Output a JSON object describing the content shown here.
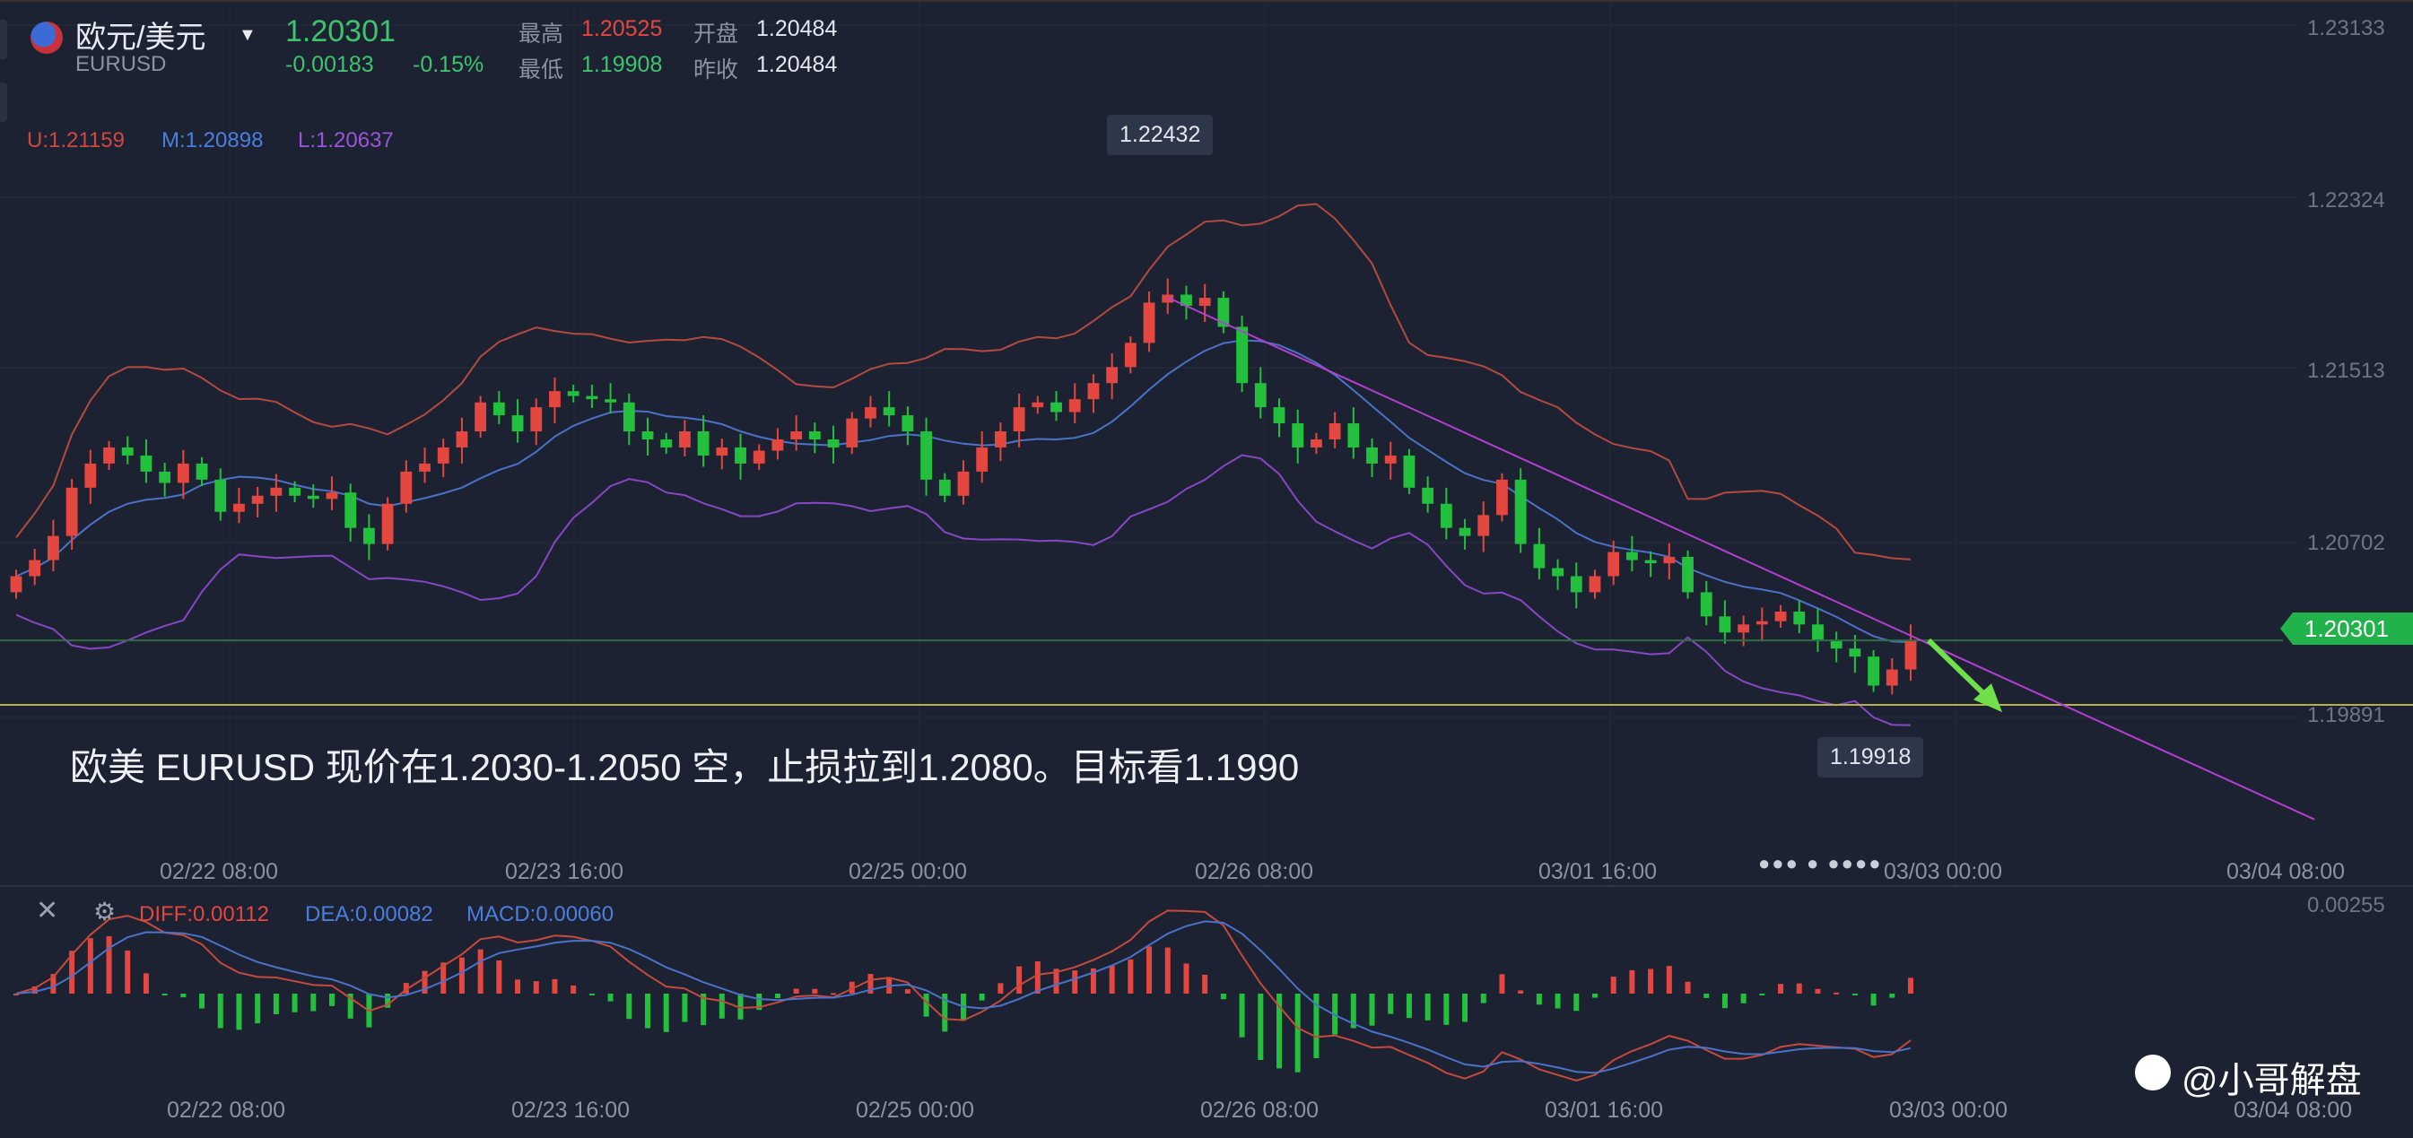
{
  "header": {
    "symbol_name": "欧元/美元",
    "symbol_code": "EURUSD",
    "price": "1.20301",
    "change": "-0.00183",
    "change_pct": "-0.15%",
    "high_label": "最高",
    "high": "1.20525",
    "low_label": "最低",
    "low": "1.19908",
    "open_label": "开盘",
    "open": "1.20484",
    "prev_close_label": "昨收",
    "prev_close": "1.20484"
  },
  "bollinger": {
    "upper": "U:1.21159",
    "middle": "M:1.20898",
    "lower": "L:1.20637"
  },
  "colors": {
    "up": "#e4473f",
    "down": "#22c03c",
    "upper": "#b44a3f",
    "middle": "#4a72c8",
    "lower": "#8746c4",
    "trendline": "#b43fd0",
    "arrow": "#6fe04a",
    "support": "#b8b04a",
    "price_line": "#2f6e43"
  },
  "annotations": {
    "high_tip": "1.22432",
    "low_tip": "1.19918",
    "current_price_tag": "1.20301",
    "note": "欧美 EURUSD 现价在1.2030-1.2050 空，止损拉到1.2080。目标看1.1990"
  },
  "y_axis": {
    "ticks": [
      "1.23133",
      "1.22324",
      "1.21513",
      "1.20702",
      "1.19891"
    ]
  },
  "x_axis": {
    "ticks": [
      "02/22 08:00",
      "02/23 16:00",
      "02/25 00:00",
      "02/26 08:00",
      "03/01 16:00",
      "03/03 00:00",
      "03/04 08:00"
    ]
  },
  "macd": {
    "close_icon": "close-icon",
    "settings_icon": "settings-icon",
    "diff": "DIFF:0.00112",
    "dea": "DEA:0.00082",
    "macd": "MACD:0.00060",
    "y_tick": "0.00255",
    "x_ticks": [
      "02/22 08:00",
      "02/23 16:00",
      "02/25 00:00",
      "02/26 08:00",
      "03/01 16:00",
      "03/03 00:00",
      "03/04 08:00"
    ]
  },
  "watermark": "@小哥解盘",
  "chart_data": {
    "type": "candlestick",
    "symbol": "EURUSD",
    "y_range": [
      1.1985,
      1.2325
    ],
    "trend": {
      "closes": [
        1.207,
        1.208,
        1.2095,
        1.2125,
        1.214,
        1.215,
        1.2145,
        1.2135,
        1.2128,
        1.214,
        1.213,
        1.211,
        1.2115,
        1.212,
        1.2125,
        1.212,
        1.2118,
        1.2122,
        1.21,
        1.209,
        1.2115,
        1.2135,
        1.214,
        1.215,
        1.216,
        1.2178,
        1.217,
        1.216,
        1.2175,
        1.2185,
        1.2182,
        1.218,
        1.2178,
        1.216,
        1.2155,
        1.215,
        1.216,
        1.2145,
        1.215,
        1.214,
        1.2148,
        1.2155,
        1.216,
        1.2155,
        1.215,
        1.2168,
        1.2175,
        1.217,
        1.216,
        1.213,
        1.212,
        1.2135,
        1.215,
        1.216,
        1.2175,
        1.2178,
        1.2172,
        1.218,
        1.219,
        1.22,
        1.2215,
        1.224,
        1.2245,
        1.2238,
        1.2243,
        1.2225,
        1.219,
        1.2175,
        1.2165,
        1.215,
        1.2155,
        1.2165,
        1.215,
        1.214,
        1.2145,
        1.2125,
        1.2115,
        1.21,
        1.2095,
        1.2108,
        1.213,
        1.209,
        1.2075,
        1.207,
        1.206,
        1.207,
        1.2085,
        1.208,
        1.2078,
        1.2082,
        1.206,
        1.2045,
        1.2035,
        1.204,
        1.2042,
        1.2048,
        1.204,
        1.203,
        1.2025,
        1.202,
        1.2002,
        1.2012,
        1.203
      ],
      "high_tip": 1.22432,
      "low_tip": 1.19918,
      "last": 1.20301
    }
  }
}
